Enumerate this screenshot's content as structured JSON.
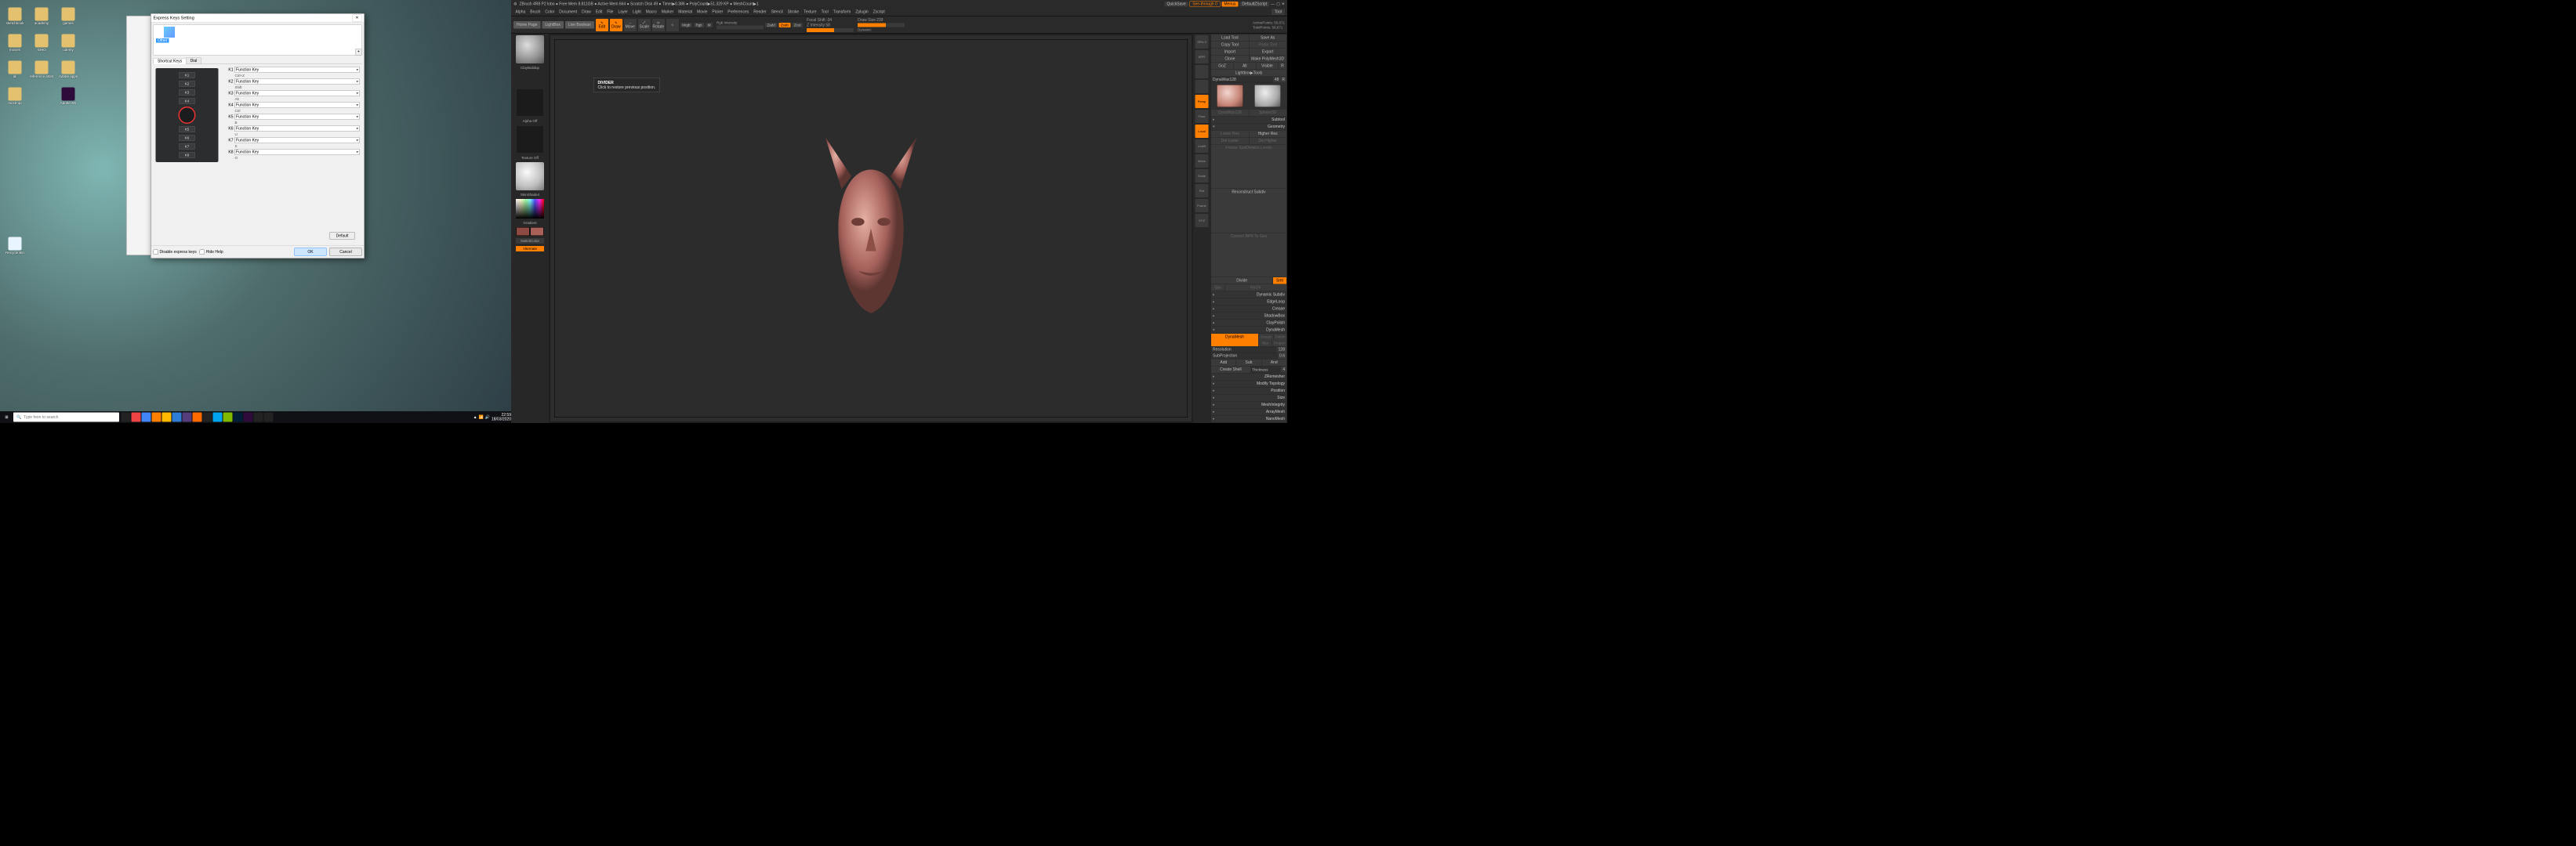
{
  "desktop": {
    "icons": [
      "sketchbook",
      "academy",
      "games",
      "",
      "",
      "",
      "movies",
      "IDHO",
      "udemy",
      "",
      "",
      "",
      "ali",
      "reference artist",
      "Adobe apps",
      "",
      "",
      "",
      "mock-up",
      "",
      "Adobe XD",
      "",
      "",
      "",
      "Recycle Bin"
    ],
    "search_placeholder": "Type here to search",
    "clock_time": "22:59",
    "clock_date": "18/03/2020"
  },
  "dialog": {
    "title": "Express Keys Setting",
    "selection": "Other",
    "tabs": [
      "Shortcut Keys",
      "Dial"
    ],
    "active_tab": 0,
    "kbuttons": [
      "K1",
      "K2",
      "K3",
      "K4",
      "K5",
      "K6",
      "K7",
      "K8"
    ],
    "defs": [
      {
        "k": "K1",
        "fn": "Function Key",
        "sub": "Ctrl+Z"
      },
      {
        "k": "K2",
        "fn": "Function Key",
        "sub": "Shift"
      },
      {
        "k": "K3",
        "fn": "Function Key",
        "sub": "Alt"
      },
      {
        "k": "K4",
        "fn": "Function Key",
        "sub": "Ctrl"
      },
      {
        "k": "K5",
        "fn": "Function Key",
        "sub": "B"
      },
      {
        "k": "K6",
        "fn": "Function Key",
        "sub": "U"
      },
      {
        "k": "K7",
        "fn": "Function Key",
        "sub": "S"
      },
      {
        "k": "K8",
        "fn": "Function Key",
        "sub": "O"
      }
    ],
    "default_btn": "Default",
    "disable": "Disable express keys",
    "hide_help": "Hide Help",
    "ok": "OK",
    "cancel": "Cancel"
  },
  "zbrush": {
    "title_left": "ZBrush 4R8 P2   lobo   ● Free Mem 8.811GB ● Active Mem 664 ● Scratch Disk 49 ● Timer▶0.386 ● PolyCount▶51.329 KP ● MeshCount▶1",
    "title_right": {
      "quicksave": "QuickSave",
      "see": "See-through  0",
      "menus": "Menus",
      "script": "DefaultZScript"
    },
    "menu": [
      "Alpha",
      "Brush",
      "Color",
      "Document",
      "Draw",
      "Edit",
      "File",
      "Layer",
      "Light",
      "Macro",
      "Marker",
      "Material",
      "Movie",
      "Picker",
      "Preferences",
      "Render",
      "Stencil",
      "Stroke",
      "Texture",
      "Tool",
      "Transform",
      "Zplugin",
      "Zscript"
    ],
    "tool_label": "Tool",
    "toolbar": {
      "home": "Home Page",
      "lightbox": "LightBox",
      "live": "Live Boolean",
      "edit": "Edit",
      "draw": "Draw",
      "move": "Move",
      "scale": "Scale",
      "rotate": "Rotate",
      "gizmo": "Gizmo",
      "mrgb": "Mrgb",
      "rgb": "Rgb",
      "m": "M",
      "zadd": "Zadd",
      "zsub": "Zsub",
      "zcut": "Zcut",
      "focal_l": "Focal Shift",
      "focal_v": "-34",
      "activepts": "ActivePoints: 50,671",
      "zint_l": "Z Intensity",
      "zint_v": "58",
      "drawsz_l": "Draw Size",
      "drawsz_v": "239",
      "totalpts": "TotalPoints: 50,671",
      "rgbint_l": "Rgb Intensity",
      "dynamic": "Dynamic"
    },
    "left": {
      "brush": "ClayBuildup",
      "alpha": "Alpha Off",
      "texture": "Texture Off",
      "material": "SkinShade4",
      "gradient": "Gradient",
      "switch": "SwitchColor",
      "alternate": "Alternate"
    },
    "tooltip": {
      "t": "DIVIDER",
      "b": "Click to restore previous position."
    },
    "sidebuttons": [
      "SPix 3",
      "BPR",
      "",
      "",
      "Persp",
      "Floor",
      "Local",
      "LiveB",
      "Move",
      "Scale",
      "Rot",
      "Frame",
      "XYZ"
    ],
    "right": {
      "row1": [
        "Load Tool",
        "Save As"
      ],
      "row2": [
        "Copy Tool",
        "Paste Tool"
      ],
      "row3": [
        "Import",
        "Export"
      ],
      "row4": [
        "Clone",
        "Make PolyMesh3D"
      ],
      "row5": [
        "GoZ",
        "All",
        "Visible",
        "R"
      ],
      "row6": [
        "Lightbox▶Tools"
      ],
      "row7_l": "DynaWax128",
      "row7_v": "48",
      "thumbs": [
        "DynaWax128",
        "Sphere3D",
        "SimpleBrush",
        "PolyMesh3D",
        "DynaWax128"
      ],
      "subtool": "Subtool",
      "geometry": "Geometry",
      "lower": "Lower Res",
      "higher": "Higher Res",
      "del_lower": "Del Lower",
      "del_higher": "Del Higher",
      "freeze": "Freeze SubDivision Levels",
      "recon": "Reconstruct Subdiv",
      "convert": "Convert BPR To Geo",
      "divide": "Divide",
      "smt": "Smt",
      "suv": "Suv",
      "rstr": "ReUV",
      "dynsub": "Dynamic Subdiv",
      "edgeloop": "EdgeLoop",
      "crease": "Crease",
      "shadowbox": "ShadowBox",
      "claypolish": "ClayPolish",
      "dyn_head": "DynaMesh",
      "dynamesh": "DynaMesh",
      "groups": "Groups",
      "polish": "Polish",
      "blur": "Blur",
      "project": "Project",
      "res_l": "Resolution",
      "res_v": "128",
      "subp_l": "SubProjection",
      "subp_v": "0.6",
      "add": "Add",
      "sub": "Sub",
      "and": "And",
      "createshell": "Create Shell",
      "thick_l": "Thickness",
      "thick_v": "4",
      "zremesh": "ZRemesher",
      "modtop": "Modify Topology",
      "position": "Position",
      "size": "Size",
      "meshint": "MeshIntegrity",
      "array": "ArrayMesh",
      "nano": "NanoMesh"
    }
  }
}
